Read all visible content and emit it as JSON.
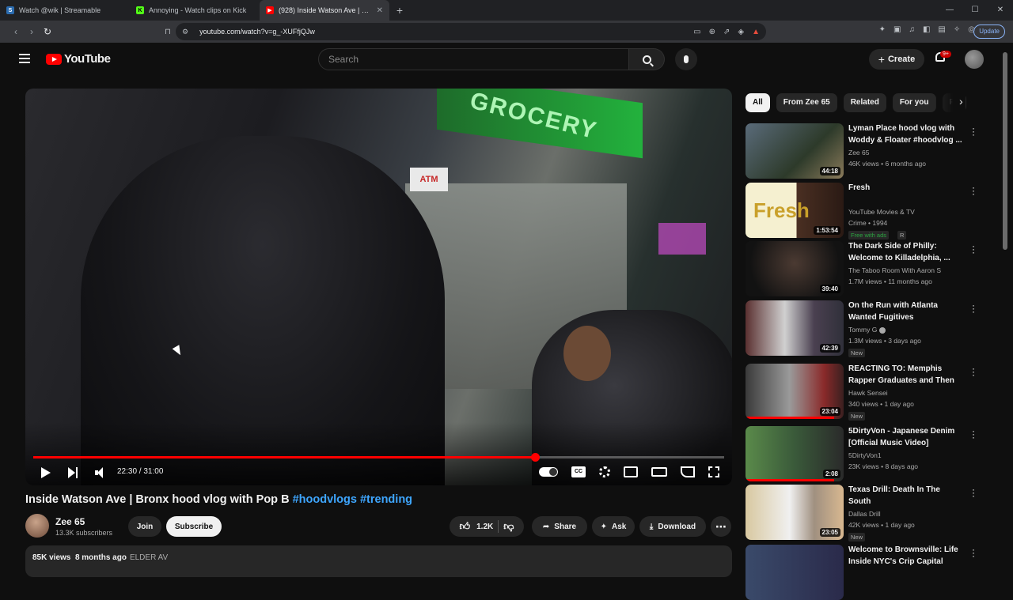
{
  "browser": {
    "tabs": [
      {
        "title": "Watch @wik | Streamable",
        "favcolor": "#2b6cb0",
        "favglyph": "S"
      },
      {
        "title": "Annoying - Watch clips on Kick",
        "favcolor": "#53fc18",
        "favglyph": "K"
      },
      {
        "title": "(928) Inside Watson Ave | Bronx",
        "favcolor": "#ff0000",
        "favglyph": "▶"
      }
    ],
    "url": "youtube.com/watch?v=g_-XUFfjQJw",
    "update_label": "Update"
  },
  "header": {
    "logo_text": "YouTube",
    "search_placeholder": "Search",
    "create_label": "Create",
    "notif_badge": "9+"
  },
  "player": {
    "time_current": "22:30",
    "time_total": "31:00",
    "progress": 0.7258,
    "sign_text": "GROCERY",
    "atm_text": "ATM"
  },
  "video": {
    "title_main": "Inside Watson Ave | Bronx hood vlog with Pop B ",
    "title_tags": "#hoodvlogs #trending",
    "channel": "Zee 65",
    "subs": "13.3K subscribers",
    "join_label": "Join",
    "subscribe_label": "Subscribe",
    "likes": "1.2K",
    "share_label": "Share",
    "ask_label": "Ask",
    "download_label": "Download",
    "views": "85K views",
    "date": "8 months ago",
    "hashtag": "ELDER AV"
  },
  "chips": [
    "All",
    "From Zee 65",
    "Related",
    "For you",
    "Re"
  ],
  "recs": [
    {
      "title": "Lyman Place hood vlog with Woddy & Floater  #hoodvlog ...",
      "channel": "Zee 65",
      "meta": "46K views • 6 months ago",
      "duration": "44:18",
      "badge": "",
      "thumb": "linear-gradient(135deg,#5a6b7a,#2d3a2a 60%,#8a7a5a)",
      "watched": 0
    },
    {
      "title": "Fresh",
      "channel": "YouTube Movies & TV",
      "meta": "Crime • 1994",
      "duration": "1:53:54",
      "badge": "Free with ads",
      "rating": "R",
      "thumb": "linear-gradient(90deg,#f5f0d0 0%,#f5f0d0 52%,#4a2f22 52%,#2a1a14 100%)",
      "watched": 0,
      "thumbtext": "Fresh"
    },
    {
      "title": "The Dark Side of Philly: Welcome to Killadelphia, ...",
      "channel": "The Taboo Room With Aaron S",
      "meta": "1.7M views • 11 months ago",
      "duration": "39:40",
      "badge": "",
      "thumb": "radial-gradient(circle at 50% 40%,#4b3a32,#121212 75%)",
      "watched": 0
    },
    {
      "title": "On the Run with Atlanta Wanted Fugitives",
      "channel": "Tommy G",
      "meta": "1.3M views • 3 days ago",
      "duration": "42:39",
      "badge": "New",
      "thumb": "linear-gradient(90deg,#5a3030,#d0d0d0 40%,#4a4050 70%,#30303a)",
      "watched": 0,
      "verified": true
    },
    {
      "title": "REACTING TO: Memphis Rapper Graduates and Then Gets ...",
      "channel": "Hawk Sensei",
      "meta": "340 views • 1 day ago",
      "duration": "23:04",
      "badge": "New",
      "thumb": "linear-gradient(90deg,#3a3a3a,#9a9a9a 45%,#8a2a2a 80%,#3a2020)",
      "watched": 0.9
    },
    {
      "title": "5DirtyVon - Japanese Denim [Official Music Video]",
      "channel": "5DirtyVon1",
      "meta": "23K views • 8 days ago",
      "duration": "2:08",
      "badge": "",
      "thumb": "linear-gradient(90deg,#5a8a4a,#3a5a3a 50%,#2a2a2a)",
      "watched": 0.9
    },
    {
      "title": "Texas Drill: Death In The South",
      "channel": "Dallas Drill",
      "meta": "42K views • 1 day ago",
      "duration": "23:05",
      "badge": "New",
      "thumb": "linear-gradient(90deg,#d8c8a0,#f0f0f0 45%,#a09080 70%,#d8b890)",
      "watched": 0
    },
    {
      "title": "Welcome to Brownsville: Life Inside NYC's Crip Capital",
      "channel": "",
      "meta": "",
      "duration": "",
      "badge": "",
      "thumb": "linear-gradient(90deg,#3a4a6a,#2a2a4a)",
      "watched": 0
    }
  ]
}
